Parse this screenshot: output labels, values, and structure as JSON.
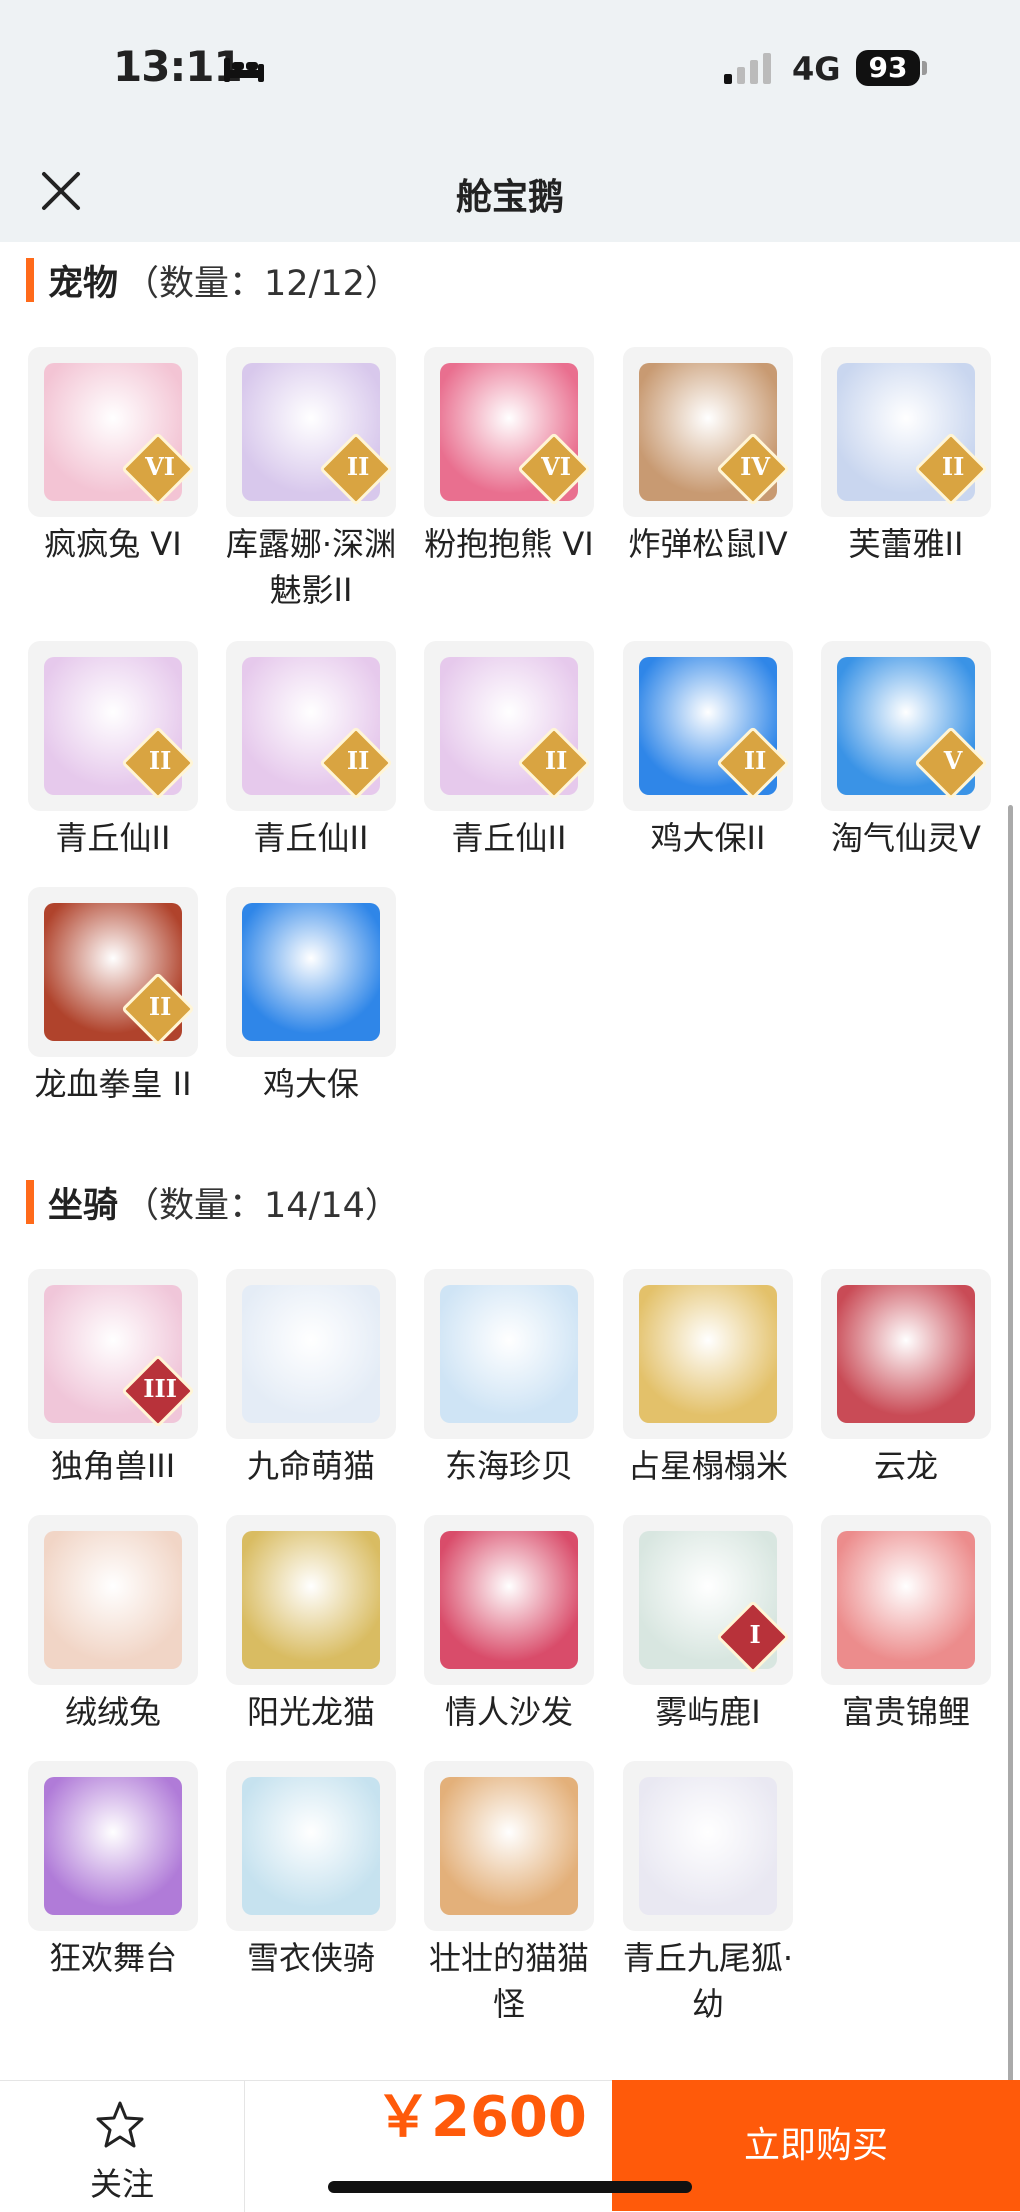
{
  "status_bar": {
    "time": "13:11",
    "network": "4G",
    "battery": "93"
  },
  "header": {
    "title": "舱宝鹅"
  },
  "pets": {
    "title": "宠物",
    "count": "（数量：12/12）",
    "items": [
      {
        "name": "疯疯兔 VI",
        "badge": "VI",
        "color": "#f3c4d4"
      },
      {
        "name": "库露娜·深渊魅影II",
        "badge": "II",
        "color": "#d8c8ec"
      },
      {
        "name": "粉抱抱熊 VI",
        "badge": "VI",
        "color": "#e96f8f"
      },
      {
        "name": "炸弹松鼠IV",
        "badge": "IV",
        "color": "#c89a72"
      },
      {
        "name": "芙蕾雅II",
        "badge": "II",
        "color": "#c9d6ef"
      },
      {
        "name": "青丘仙II",
        "badge": "II",
        "color": "#e6c9ec"
      },
      {
        "name": "青丘仙II",
        "badge": "II",
        "color": "#e6c9ec"
      },
      {
        "name": "青丘仙II",
        "badge": "II",
        "color": "#e6c9ec"
      },
      {
        "name": "鸡大保II",
        "badge": "II",
        "color": "#2f86e8"
      },
      {
        "name": "淘气仙灵V",
        "badge": "V",
        "color": "#3a93e6"
      },
      {
        "name": "龙血拳皇 II",
        "badge": "II",
        "color": "#b0432c"
      },
      {
        "name": "鸡大保",
        "badge": "",
        "color": "#2f86e8"
      }
    ]
  },
  "mounts": {
    "title": "坐骑",
    "count": "（数量：14/14）",
    "items": [
      {
        "name": "独角兽III",
        "badge": "III",
        "color": "#f0c6d9"
      },
      {
        "name": "九命萌猫",
        "badge": "",
        "color": "#e4ecf6"
      },
      {
        "name": "东海珍贝",
        "badge": "",
        "color": "#cfe4f5"
      },
      {
        "name": "占星榻榻米",
        "badge": "",
        "color": "#e3c16a"
      },
      {
        "name": "云龙",
        "badge": "",
        "color": "#c94b56"
      },
      {
        "name": "绒绒兔",
        "badge": "",
        "color": "#f1d5c6"
      },
      {
        "name": "阳光龙猫",
        "badge": "",
        "color": "#d9bc62"
      },
      {
        "name": "情人沙发",
        "badge": "",
        "color": "#d94c6a"
      },
      {
        "name": "雾屿鹿I",
        "badge": "I",
        "color": "#d8e6e0"
      },
      {
        "name": "富贵锦鲤",
        "badge": "",
        "color": "#ec8c8c"
      },
      {
        "name": "狂欢舞台",
        "badge": "",
        "color": "#b07bd8"
      },
      {
        "name": "雪衣侠骑",
        "badge": "",
        "color": "#c6e2ef"
      },
      {
        "name": "壮壮的猫猫怪",
        "badge": "",
        "color": "#e3b07a"
      },
      {
        "name": "青丘九尾狐·幼",
        "badge": "",
        "color": "#e9e8f2"
      }
    ]
  },
  "bottom_bar": {
    "favorite_label": "关注",
    "price": "￥2600",
    "buy_label": "立即购买"
  },
  "colors": {
    "accent": "#ff5a0a",
    "section_bar": "#ff6a1a",
    "badge_gold": "#d9a441",
    "badge_red": "#b8323a"
  }
}
